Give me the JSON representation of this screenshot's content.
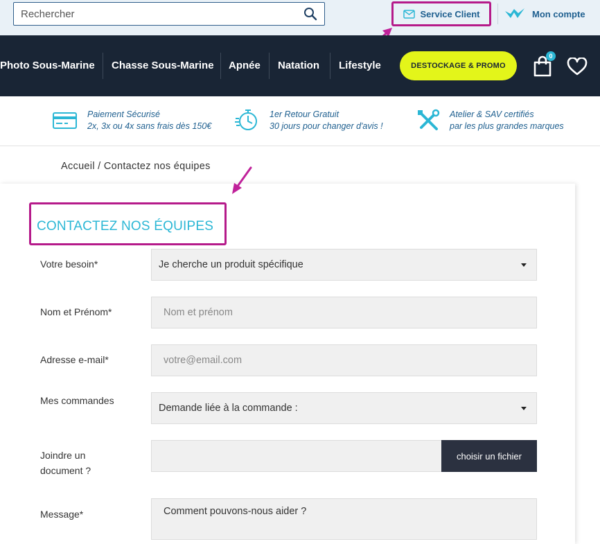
{
  "header": {
    "search_placeholder": "Rechercher",
    "service_client": "Service Client",
    "account": "Mon compte"
  },
  "nav": {
    "items": [
      "Photo Sous-Marine",
      "Chasse Sous-Marine",
      "Apnée",
      "Natation",
      "Lifestyle"
    ],
    "promo": "DESTOCKAGE & PROMO",
    "cart_count": "0"
  },
  "reassurance": [
    {
      "icon": "credit-card-icon",
      "line1": "Paiement Sécurisé",
      "line2": "2x, 3x ou 4x sans frais dès 150€"
    },
    {
      "icon": "stopwatch-icon",
      "line1": "1er Retour Gratuit",
      "line2": "30 jours pour changer d'avis !"
    },
    {
      "icon": "tools-icon",
      "line1": "Atelier & SAV certifiés",
      "line2": "par les plus grandes marques"
    }
  ],
  "breadcrumb": "Accueil / Contactez nos équipes",
  "form": {
    "title": "CONTACTEZ NOS ÉQUIPES",
    "need_label": "Votre besoin*",
    "need_value": "Je cherche un produit spécifique",
    "name_label": "Nom et Prénom*",
    "name_placeholder": "Nom et prénom",
    "email_label": "Adresse e-mail*",
    "email_placeholder": "votre@email.com",
    "orders_label": "Mes commandes",
    "orders_value": "Demande liée à la commande :",
    "attach_label_1": "Joindre un",
    "attach_label_2": "document ?",
    "attach_button": "choisir un fichier",
    "message_label": "Message*",
    "message_placeholder": "Comment pouvons-nous aider ?"
  },
  "colors": {
    "accent": "#2bb7d5",
    "nav_bg": "#192535",
    "promo": "#e3f51a",
    "highlight": "#b51a8a",
    "link": "#1e5f8f"
  }
}
